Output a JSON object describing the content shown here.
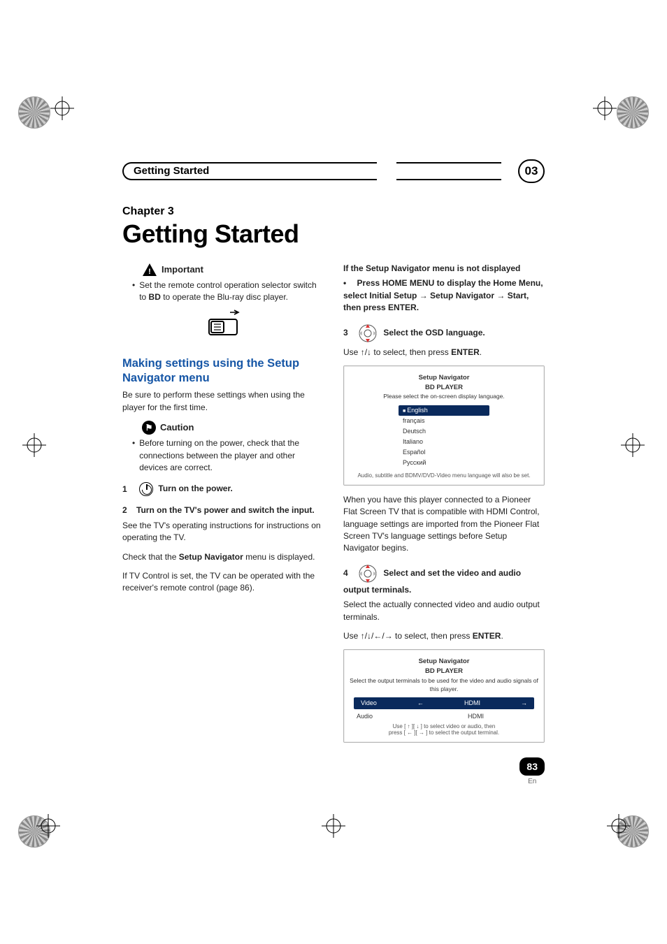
{
  "header": {
    "section": "Getting Started",
    "chapter_num": "03"
  },
  "chapter": {
    "label": "Chapter 3",
    "title": "Getting Started"
  },
  "left": {
    "important_label": "Important",
    "important_bullet_a": "Set the remote control operation selector switch to ",
    "important_bullet_bold": "BD",
    "important_bullet_b": " to operate the Blu-ray disc player.",
    "section_heading": "Making settings using the Setup Navigator menu",
    "section_intro": "Be sure to perform these settings when using the player for the first time.",
    "caution_label": "Caution",
    "caution_bullet": "Before turning on the power, check that the connections between the player and other devices are correct.",
    "step1_num": "1",
    "step1_title": "Turn on the power.",
    "step2_num": "2",
    "step2_title": "Turn on the TV's power and switch the input.",
    "step2_p1": "See the TV's operating instructions for instructions on operating the TV.",
    "step2_p2a": "Check that the ",
    "step2_p2_bold": "Setup Navigator",
    "step2_p2b": " menu is displayed.",
    "step2_p3": "If TV Control is set, the TV can be operated with the receiver's remote control (page 86)."
  },
  "right": {
    "cond_heading": "If the Setup Navigator menu is not displayed",
    "cond_bullet": "•  Press HOME MENU to display the Home Menu, select Initial Setup → Setup Navigator → Start, then press ENTER.",
    "step3_num": "3",
    "step3_title": "Select the OSD language.",
    "step3_p_a": "Use ",
    "step3_p_b": " to select, then press ",
    "step3_p_bold": "ENTER",
    "step3_p_c": ".",
    "osd1": {
      "t1": "Setup Navigator",
      "t2": "BD PLAYER",
      "prompt": "Please select the on-screen display language.",
      "langs": [
        "English",
        "français",
        "Deutsch",
        "Italiano",
        "Español",
        "Русский"
      ],
      "foot": "Audio, subtitle and BDMV/DVD-Video menu language will also be set."
    },
    "after_osd1": "When you have this player connected to a Pioneer Flat Screen TV that is compatible with HDMI Control, language settings are imported from the Pioneer Flat Screen TV's language settings before Setup Navigator begins.",
    "step4_num": "4",
    "step4_title": "Select and set the video and audio output terminals.",
    "step4_p1": "Select the actually connected video and audio output terminals.",
    "step4_p2a": "Use ",
    "step4_p2b": " to select, then press ",
    "step4_p2_bold": "ENTER",
    "step4_p2c": ".",
    "osd2": {
      "t1": "Setup Navigator",
      "t2": "BD PLAYER",
      "prompt": "Select the output terminals to be used for the video and audio signals of this player.",
      "row_video_l": "Video",
      "row_video_r": "HDMI",
      "row_audio_l": "Audio",
      "row_audio_r": "HDMI",
      "foot1": "Use [ ↑ ][ ↓ ] to select video or audio, then",
      "foot2": "press [ ← ][ → ] to select the output terminal."
    }
  },
  "footer": {
    "page": "83",
    "lang": "En"
  }
}
